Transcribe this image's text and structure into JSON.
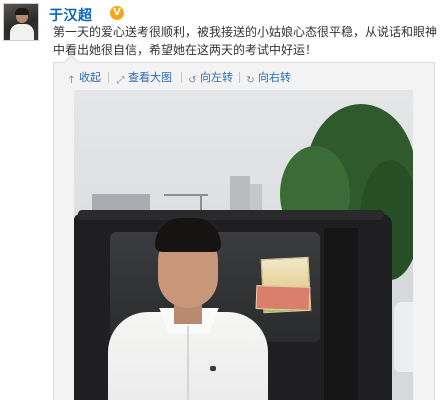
{
  "user": {
    "name": "于汉超",
    "verified_badge": "V",
    "avatar_icon": "user-avatar"
  },
  "post": {
    "text": "第一天的爱心送考很顺利，被我接送的小姑娘心态很平稳，从说话和眼神中看出她很自信，希望她在这两天的考试中好运！"
  },
  "toolbar": {
    "items": [
      {
        "label": "收起",
        "icon": "collapse-icon",
        "glyph": "↑"
      },
      {
        "label": "查看大图",
        "icon": "enlarge-icon",
        "glyph": "⤢"
      },
      {
        "label": "向左转",
        "icon": "rotate-left-icon",
        "glyph": "↺"
      },
      {
        "label": "向右转",
        "icon": "rotate-right-icon",
        "glyph": "↻"
      }
    ]
  },
  "photo": {
    "subject": "man-in-white-shirt-in-front-of-black-suv"
  },
  "colors": {
    "link_blue": "#0a66b7",
    "toolbar_blue": "#2a6cb5",
    "badge_orange": "#f6a61a",
    "text": "#333333"
  }
}
